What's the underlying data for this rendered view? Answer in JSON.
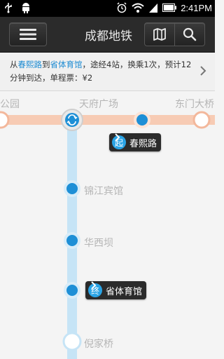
{
  "status_bar": {
    "time": "2:41PM"
  },
  "header": {
    "title": "成都地铁"
  },
  "route_info": {
    "from_prefix": "从",
    "origin": "春熙路",
    "to_word": "到",
    "destination": "省体育馆",
    "summary": "，途经4站，换乘1次，预计12分钟到达，单程票：¥2"
  },
  "map": {
    "stations": [
      {
        "name": "公园"
      },
      {
        "name": "天府广场"
      },
      {
        "name": "东门大桥"
      },
      {
        "name": "锦江宾馆"
      },
      {
        "name": "华西坝"
      },
      {
        "name": "倪家桥"
      }
    ],
    "start_tag": {
      "badge": "起",
      "label": "春熙路"
    },
    "end_tag": {
      "badge": "终",
      "label": "省体育馆"
    }
  },
  "colors": {
    "line_vertical": "#c6e4f6",
    "line_horizontal": "#f7cbb4",
    "station_blue": "#1e8fd6",
    "highlight": "#1a8ad2"
  }
}
